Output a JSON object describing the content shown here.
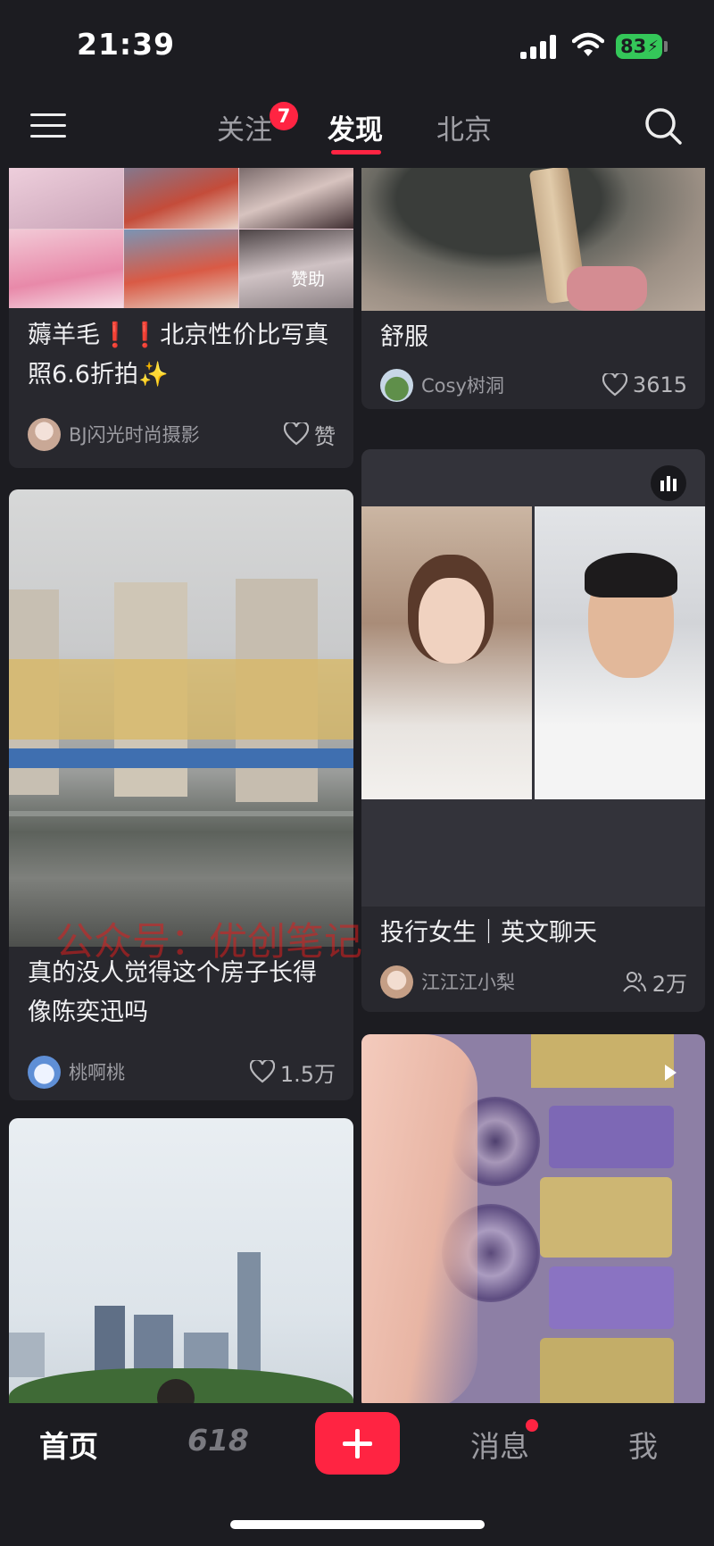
{
  "status_bar": {
    "time": "21:39",
    "battery": "83"
  },
  "top_nav": {
    "tabs": [
      {
        "label": "关注",
        "badge": "7"
      },
      {
        "label": "发现"
      },
      {
        "label": "北京"
      }
    ],
    "active_tab": "发现"
  },
  "feed": {
    "left": [
      {
        "title": "薅羊毛❗❗北京性价比写真照6.6折拍✨",
        "author": "BJ闪光时尚摄影",
        "likes": "赞",
        "overlay": "赞助"
      },
      {
        "title": "真的没人觉得这个房子长得像陈奕迅吗",
        "author": "桃啊桃",
        "likes": "1.5万"
      }
    ],
    "right": [
      {
        "title": "舒服",
        "author": "Cosy树洞",
        "likes": "3615"
      },
      {
        "title": "投行女生｜英文聊天",
        "author": "江江江小梨",
        "likes": "2万"
      }
    ]
  },
  "watermark": "公众号：优创笔记",
  "tab_bar": {
    "home": "首页",
    "promo": "618",
    "messages": "消息",
    "me": "我"
  },
  "colors": {
    "accent": "#ff2442",
    "background": "#1c1c21",
    "card": "#28282e"
  }
}
